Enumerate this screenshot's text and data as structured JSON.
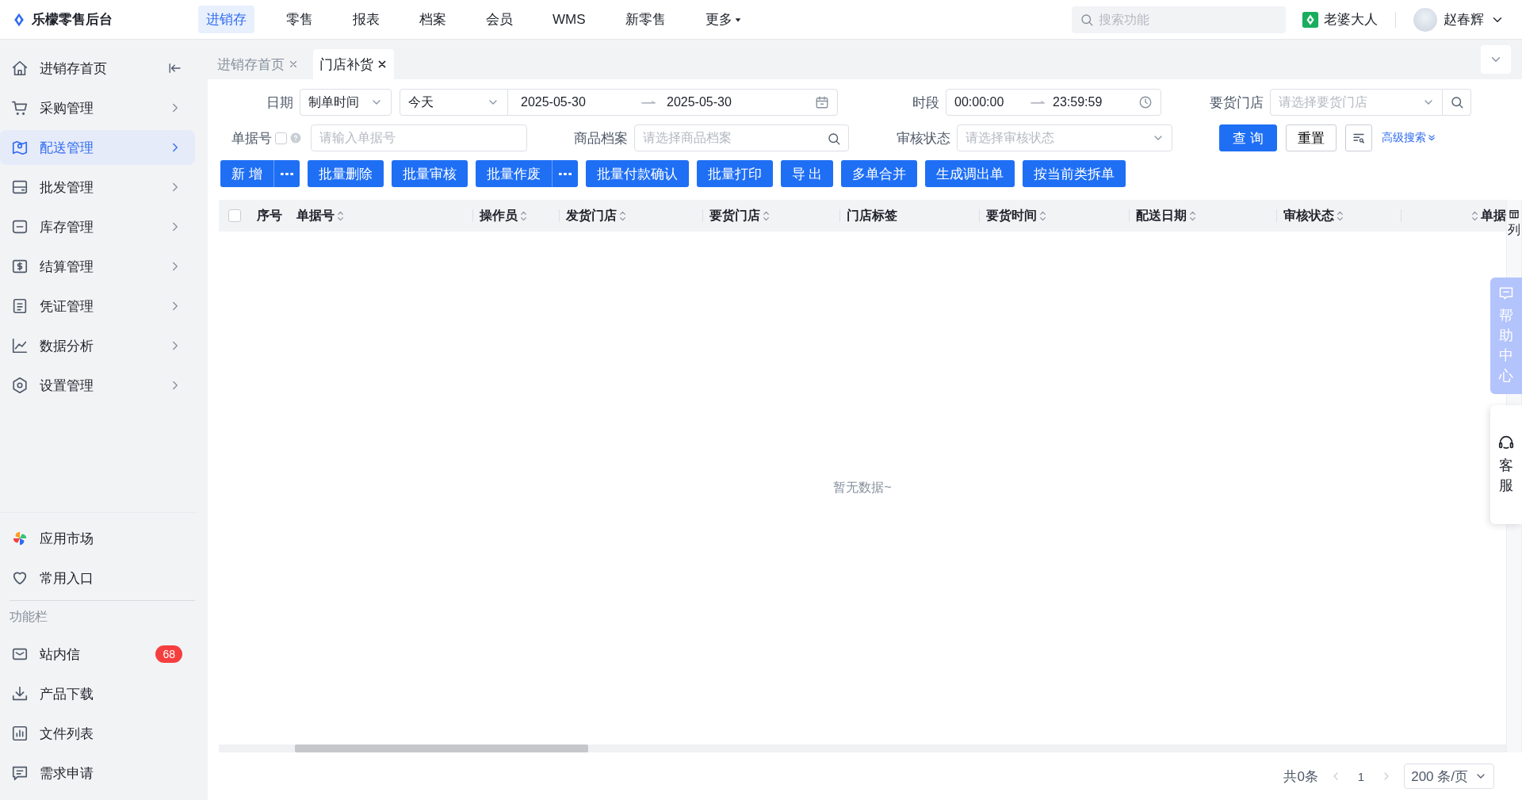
{
  "header": {
    "logo": "乐檬零售后台",
    "nav": [
      {
        "label": "进销存",
        "selected": true,
        "kind": "link"
      },
      {
        "label": "零售",
        "selected": false,
        "kind": "link"
      },
      {
        "label": "报表",
        "selected": false,
        "kind": "link"
      },
      {
        "label": "档案",
        "selected": false,
        "kind": "link"
      },
      {
        "label": "会员",
        "selected": false,
        "kind": "link"
      },
      {
        "label": "WMS",
        "selected": false,
        "kind": "link"
      },
      {
        "label": "新零售",
        "selected": false,
        "kind": "link"
      },
      {
        "label": "更多",
        "selected": false,
        "kind": "dropdown"
      }
    ],
    "search": {
      "placeholder": "搜索功能"
    },
    "store": "老婆大人",
    "user": "赵春辉"
  },
  "sidebar": {
    "items": [
      {
        "label": "进销存首页",
        "selected": false,
        "kind": "collapse"
      },
      {
        "label": "采购管理",
        "selected": false,
        "kind": "menu"
      },
      {
        "label": "配送管理",
        "selected": true,
        "kind": "menu"
      },
      {
        "label": "批发管理",
        "selected": false,
        "kind": "menu"
      },
      {
        "label": "库存管理",
        "selected": false,
        "kind": "menu"
      },
      {
        "label": "结算管理",
        "selected": false,
        "kind": "menu"
      },
      {
        "label": "凭证管理",
        "selected": false,
        "kind": "menu"
      },
      {
        "label": "数据分析",
        "selected": false,
        "kind": "menu"
      },
      {
        "label": "设置管理",
        "selected": false,
        "kind": "menu"
      }
    ],
    "apps": [
      {
        "label": "应用市场"
      },
      {
        "label": "常用入口"
      }
    ],
    "section_title": "功能栏",
    "tools": [
      {
        "label": "站内信",
        "badge": "68"
      },
      {
        "label": "产品下载"
      },
      {
        "label": "文件列表"
      },
      {
        "label": "需求申请"
      }
    ]
  },
  "tabs": [
    {
      "label": "进销存首页",
      "selected": false
    },
    {
      "label": "门店补货",
      "selected": true
    }
  ],
  "filters": {
    "date": {
      "label": "日期",
      "type": "制单时间",
      "range": "今天",
      "start": "2025-05-30",
      "end": "2025-05-30"
    },
    "period": {
      "label": "时段",
      "start": "00:00:00",
      "end": "23:59:59"
    },
    "store": {
      "label": "要货门店",
      "placeholder": "请选择要货门店"
    },
    "order_no": {
      "label": "单据号",
      "checked": false,
      "placeholder": "请输入单据号"
    },
    "product": {
      "label": "商品档案",
      "placeholder": "请选择商品档案"
    },
    "status": {
      "label": "审核状态",
      "placeholder": "请选择审核状态"
    },
    "query": "查 询",
    "reset": "重置",
    "advanced": "高级搜索"
  },
  "actions": [
    {
      "label": "新 增",
      "more": true
    },
    {
      "label": "批量删除",
      "more": false
    },
    {
      "label": "批量审核",
      "more": false
    },
    {
      "label": "批量作废",
      "more": true
    },
    {
      "label": "批量付款确认",
      "more": false
    },
    {
      "label": "批量打印",
      "more": false
    },
    {
      "label": "导 出",
      "more": false
    },
    {
      "label": "多单合并",
      "more": false
    },
    {
      "label": "生成调出单",
      "more": false
    },
    {
      "label": "按当前类拆单",
      "more": false
    }
  ],
  "table": {
    "select_all": false,
    "columns": [
      {
        "label": "序号",
        "sortable": false
      },
      {
        "label": "单据号",
        "sortable": true
      },
      {
        "label": "操作员",
        "sortable": true
      },
      {
        "label": "发货门店",
        "sortable": true
      },
      {
        "label": "要货门店",
        "sortable": true
      },
      {
        "label": "门店标签",
        "sortable": false
      },
      {
        "label": "要货时间",
        "sortable": true
      },
      {
        "label": "配送日期",
        "sortable": true
      },
      {
        "label": "审核状态",
        "sortable": true
      },
      {
        "label": "单据",
        "sortable": true
      }
    ],
    "column_setting": "列",
    "empty": "暂无数据~"
  },
  "pagination": {
    "total": "共0条",
    "page": "1",
    "page_size": "200 条/页"
  },
  "float": {
    "help": "帮助中心",
    "service": "客服"
  }
}
